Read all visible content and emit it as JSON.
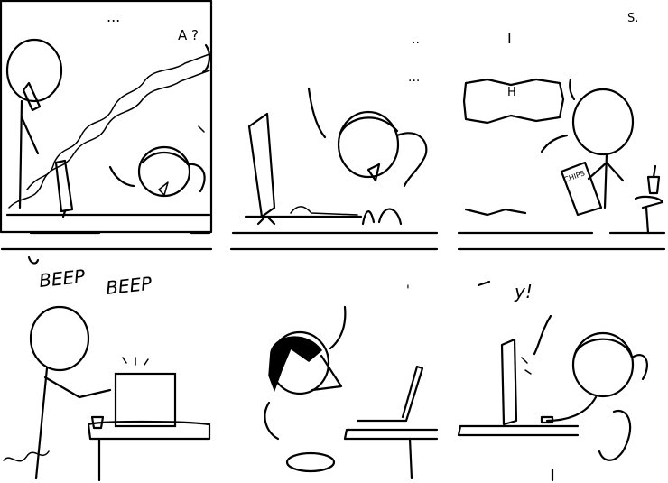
{
  "panels": [
    {
      "texts": {
        "ellipsis": "...",
        "trail": "A ?"
      }
    },
    {
      "texts": {
        "dots1": "..",
        "dots2": "..."
      }
    },
    {
      "texts": {
        "top_right": "S.",
        "top_left": "I",
        "sign": "H",
        "chips_bag": "CHIPS"
      }
    },
    {
      "texts": {
        "beep1": "BEEP",
        "beep2": "BEEP"
      }
    },
    {
      "texts": {
        "mark": "'"
      }
    },
    {
      "texts": {
        "exclaim": "y!"
      }
    }
  ],
  "colors": {
    "ink": "#000000",
    "background": "#ffffff"
  }
}
